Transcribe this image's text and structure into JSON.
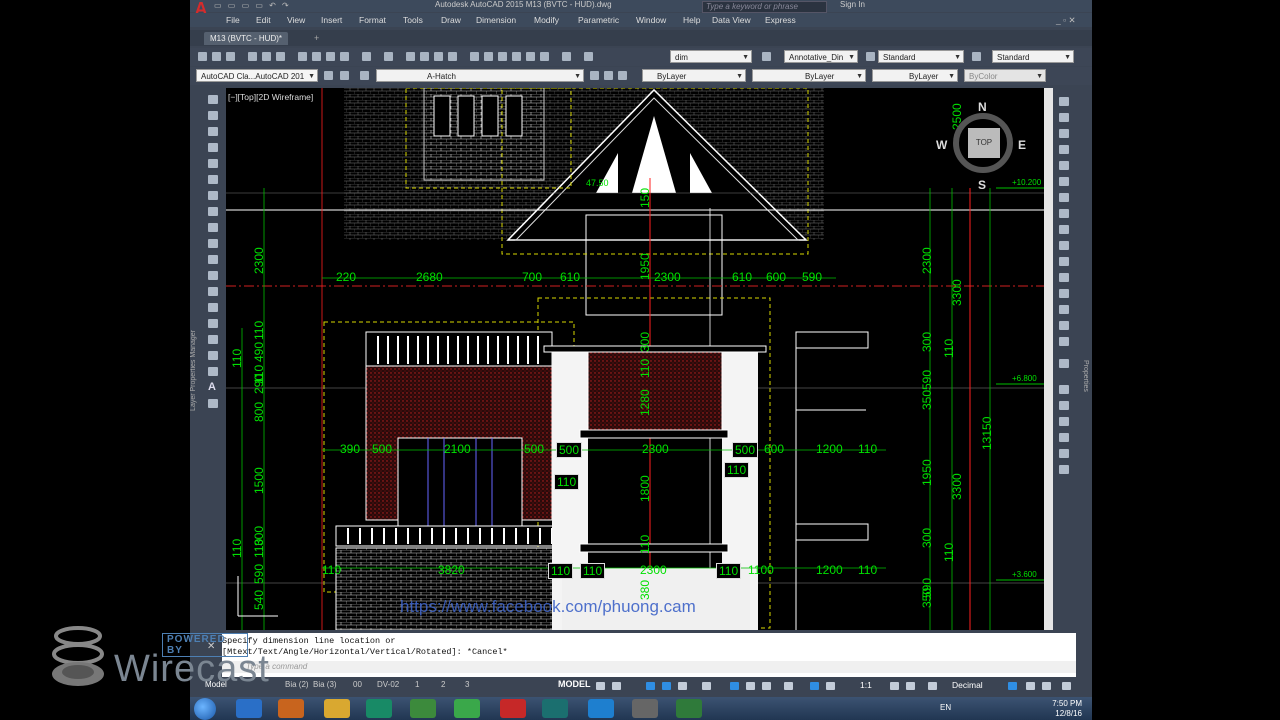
{
  "window": {
    "title": "Autodesk AutoCAD 2015   M13 (BVTC - HUD).dwg",
    "search_placeholder": "Type a keyword or phrase",
    "signin": "Sign In"
  },
  "menu": [
    "File",
    "Edit",
    "View",
    "Insert",
    "Format",
    "Tools",
    "Draw",
    "Dimension",
    "Modify",
    "Parametric",
    "Window",
    "Help",
    "Data View",
    "Express"
  ],
  "file_tab": "M13 (BVTC - HUD)*",
  "toolbar": {
    "dimstyle": "dim",
    "textstyle": "Annotative_Din",
    "tablestyle": "Standard",
    "multileaderstyle": "Standard",
    "workspace": "AutoCAD Cla...AutoCAD 201",
    "layer": "A-Hatch",
    "color": "ByLayer",
    "linetype": "ByLayer",
    "lineweight": "ByLayer",
    "plotstyle": "ByColor"
  },
  "side_palette_left": "Layer Properties Manager",
  "side_palette_right": "Properties",
  "viewport": {
    "label": "[−][Top][2D Wireframe]",
    "viewcube": {
      "n": "N",
      "s": "S",
      "e": "E",
      "w": "W",
      "top": "TOP"
    }
  },
  "drawing": {
    "dims_top_row": [
      "220",
      "2680",
      "700",
      "610",
      "2300",
      "610",
      "600",
      "590"
    ],
    "dims_mid_row": [
      "390",
      "500",
      "2100",
      "500",
      "500",
      "2300",
      "500",
      "600",
      "1200",
      "110"
    ],
    "dims_bottom_row": [
      "110",
      "3820",
      "110",
      "110",
      "2300",
      "110",
      "1100",
      "1200",
      "110"
    ],
    "dims_left_col": [
      "2300",
      "110",
      "490",
      "110",
      "290",
      "800",
      "1500",
      "300",
      "110",
      "590",
      "540"
    ],
    "dims_left_outer": [
      "110",
      "110"
    ],
    "dims_center_col": [
      "150",
      "1950",
      "300",
      "110",
      "1280",
      "1800",
      "110",
      "380"
    ],
    "dims_right_col": [
      "2500",
      "2300",
      "3300",
      "300",
      "110",
      "590",
      "350",
      "1950",
      "3300",
      "300",
      "110",
      "590",
      "350"
    ],
    "dims_far_right": "13150",
    "dims_small": [
      "110",
      "110"
    ],
    "levels": [
      "+10.200",
      "+6.800",
      "+3.600"
    ],
    "roof_dim": "47.50"
  },
  "command": {
    "line1": "Specify dimension line location or",
    "line2": "[Mtext/Text/Angle/Horizontal/Vertical/Rotated]: *Cancel*",
    "input_placeholder": "Type a command"
  },
  "layout_tabs": [
    "Model",
    "Bia (2)",
    "Bia (3)",
    "00",
    "DV-02",
    "1",
    "2",
    "3"
  ],
  "status": {
    "model": "MODEL",
    "scale": "1:1",
    "units": "Decimal"
  },
  "taskbar": {
    "lang": "EN",
    "time": "7:50 PM",
    "date": "12/8/16"
  },
  "overlay": {
    "wirecast_powered": "POWERED BY",
    "wirecast_name": "Wirecast",
    "facebook": "https://www.facebook.com/phuong.cam"
  },
  "colors": {
    "dimension": "#00e000",
    "axis": "#ff2020",
    "hatch": "#b22222",
    "outline": "#ffffff",
    "guide": "#d8d800"
  }
}
